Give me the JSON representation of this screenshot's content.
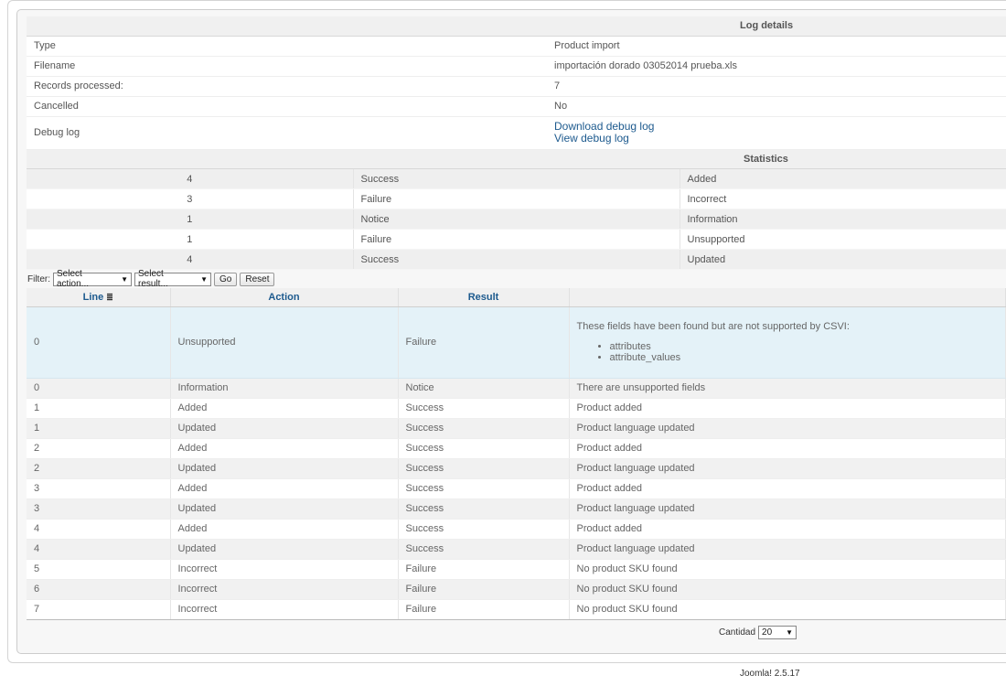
{
  "details": {
    "heading": "Log details",
    "rows": [
      {
        "label": "Type",
        "value": "Product import"
      },
      {
        "label": "Filename",
        "value": "importación dorado 03052014 prueba.xls"
      },
      {
        "label": "Records processed:",
        "value": "7"
      },
      {
        "label": "Cancelled",
        "value": "No"
      }
    ],
    "debug_label": "Debug log",
    "download_link": "Download debug log",
    "view_link": "View debug log"
  },
  "statistics": {
    "heading": "Statistics",
    "rows": [
      {
        "count": "4",
        "result": "Success",
        "action": "Added"
      },
      {
        "count": "3",
        "result": "Failure",
        "action": "Incorrect"
      },
      {
        "count": "1",
        "result": "Notice",
        "action": "Information"
      },
      {
        "count": "1",
        "result": "Failure",
        "action": "Unsupported"
      },
      {
        "count": "4",
        "result": "Success",
        "action": "Updated"
      }
    ]
  },
  "filter": {
    "label": "Filter:",
    "action_select": "Select action...",
    "result_select": "Select result...",
    "go": "Go",
    "reset": "Reset"
  },
  "log": {
    "columns": {
      "line": "Line",
      "action": "Action",
      "result": "Result",
      "message": ""
    },
    "first": {
      "line": "0",
      "action": "Unsupported",
      "result": "Failure",
      "message": "These fields have been found but are not supported by CSVI:",
      "fields": [
        "attributes",
        "attribute_values"
      ]
    },
    "rows": [
      {
        "line": "0",
        "action": "Information",
        "result": "Notice",
        "message": "There are unsupported fields"
      },
      {
        "line": "1",
        "action": "Added",
        "result": "Success",
        "message": "Product added"
      },
      {
        "line": "1",
        "action": "Updated",
        "result": "Success",
        "message": "Product language updated"
      },
      {
        "line": "2",
        "action": "Added",
        "result": "Success",
        "message": "Product added"
      },
      {
        "line": "2",
        "action": "Updated",
        "result": "Success",
        "message": "Product language updated"
      },
      {
        "line": "3",
        "action": "Added",
        "result": "Success",
        "message": "Product added"
      },
      {
        "line": "3",
        "action": "Updated",
        "result": "Success",
        "message": "Product language updated"
      },
      {
        "line": "4",
        "action": "Added",
        "result": "Success",
        "message": "Product added"
      },
      {
        "line": "4",
        "action": "Updated",
        "result": "Success",
        "message": "Product language updated"
      },
      {
        "line": "5",
        "action": "Incorrect",
        "result": "Failure",
        "message": "No product SKU found"
      },
      {
        "line": "6",
        "action": "Incorrect",
        "result": "Failure",
        "message": "No product SKU found"
      },
      {
        "line": "7",
        "action": "Incorrect",
        "result": "Failure",
        "message": "No product SKU found"
      }
    ]
  },
  "pager": {
    "label": "Cantidad",
    "value": "20"
  },
  "footer": "Joomla! 2.5.17"
}
